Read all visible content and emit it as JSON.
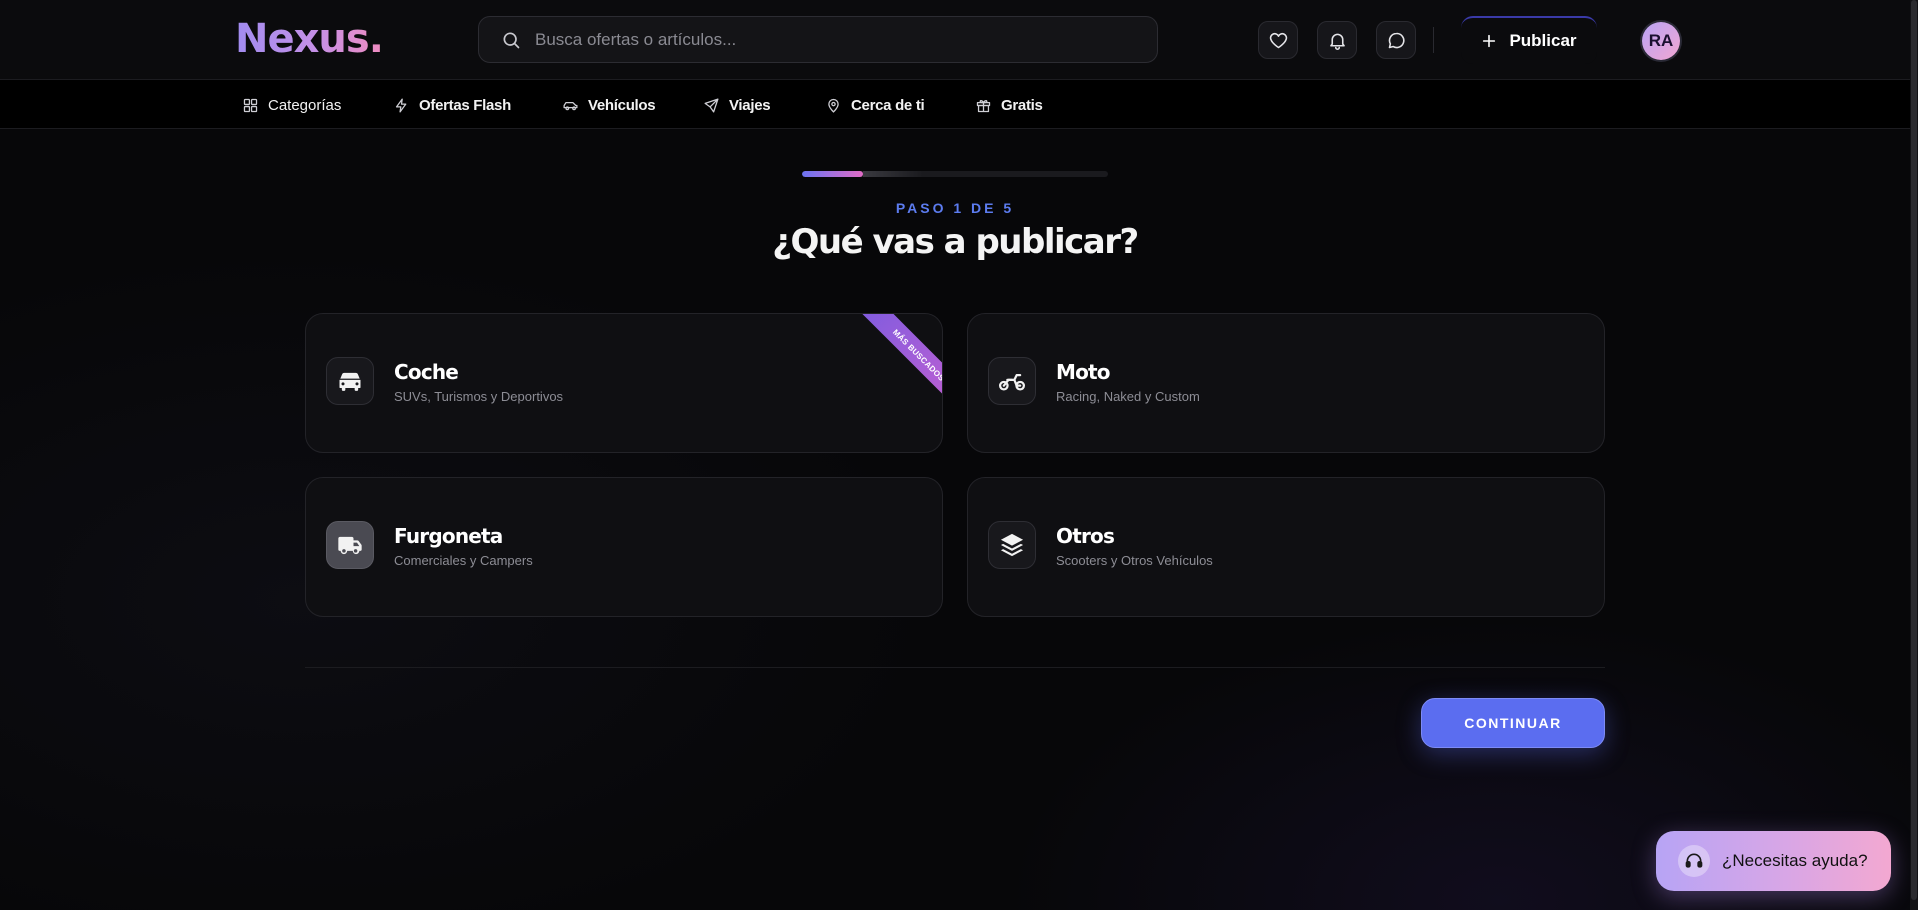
{
  "header": {
    "logo": "Nexus.",
    "search_placeholder": "Busca ofertas o artículos...",
    "publish_label": "Publicar",
    "avatar_initials": "RA"
  },
  "nav": {
    "items": [
      {
        "label": "Categorías",
        "icon": "grid-icon"
      },
      {
        "label": "Ofertas Flash",
        "icon": "lightning-icon"
      },
      {
        "label": "Vehículos",
        "icon": "car-icon"
      },
      {
        "label": "Viajes",
        "icon": "plane-icon"
      },
      {
        "label": "Cerca de ti",
        "icon": "map-pin-icon"
      },
      {
        "label": "Gratis",
        "icon": "gift-icon"
      }
    ]
  },
  "wizard": {
    "progress": 0.2,
    "step_label": "PASO 1 DE 5",
    "title": "¿Qué vas a publicar?",
    "options": [
      {
        "title": "Coche",
        "subtitle": "SUVs, Turismos y Deportivos",
        "icon": "car-icon",
        "badge": "MÁS BUSCADOS"
      },
      {
        "title": "Moto",
        "subtitle": "Racing, Naked y Custom",
        "icon": "motorcycle-icon"
      },
      {
        "title": "Furgoneta",
        "subtitle": "Comerciales y Campers",
        "icon": "truck-icon"
      },
      {
        "title": "Otros",
        "subtitle": "Scooters y Otros Vehículos",
        "icon": "layers-icon"
      }
    ],
    "continue_label": "CONTINUAR"
  },
  "help": {
    "label": "¿Necesitas ayuda?",
    "icon": "headset-icon"
  },
  "colors": {
    "accent": "#5b6df0",
    "progress_start": "#6b73f2",
    "progress_end": "#e06cc6",
    "step_label": "#5c7cf0",
    "background": "#070709"
  }
}
